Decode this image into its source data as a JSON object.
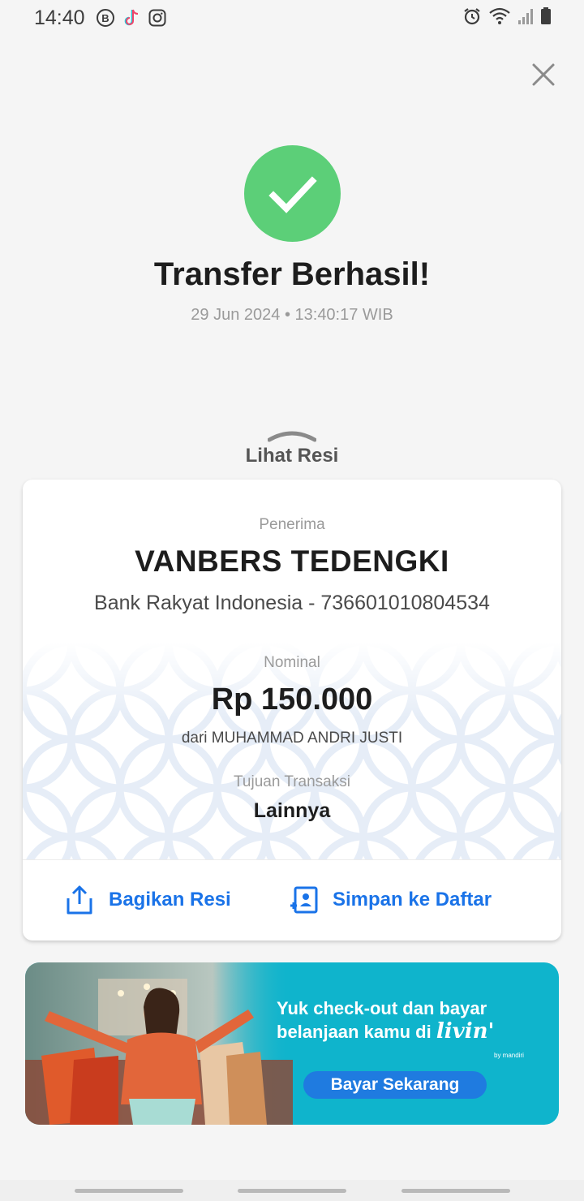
{
  "status_bar": {
    "time": "14:40",
    "left_icons": [
      "b-circle-icon",
      "tiktok-icon",
      "instagram-icon"
    ],
    "right_icons": [
      "alarm-icon",
      "wifi-icon",
      "signal-icon",
      "battery-icon"
    ]
  },
  "header": {
    "close_icon": "close-icon"
  },
  "success": {
    "icon": "check-icon",
    "color": "#5ccf78",
    "title": "Transfer Berhasil!",
    "datetime": "29 Jun 2024 • 13:40:17 WIB"
  },
  "receipt_toggle": {
    "label": "Lihat Resi"
  },
  "receipt": {
    "recipient_label": "Penerima",
    "recipient_name": "VANBERS TEDENGKI",
    "recipient_bank": "Bank Rakyat Indonesia - 736601010804534",
    "amount_label": "Nominal",
    "amount": "Rp 150.000",
    "sender": "dari MUHAMMAD ANDRI JUSTI",
    "purpose_label": "Tujuan Transaksi",
    "purpose": "Lainnya",
    "share_label": "Bagikan Resi",
    "save_label": "Simpan ke Daftar",
    "accent": "#1a73e8"
  },
  "banner": {
    "text_line1": "Yuk check-out dan bayar",
    "text_line2": "belanjaan kamu di",
    "brand": "livin'",
    "brand_sub": "by mandiri",
    "button_label": "Bayar Sekarang",
    "background": "#0fb4cc"
  }
}
